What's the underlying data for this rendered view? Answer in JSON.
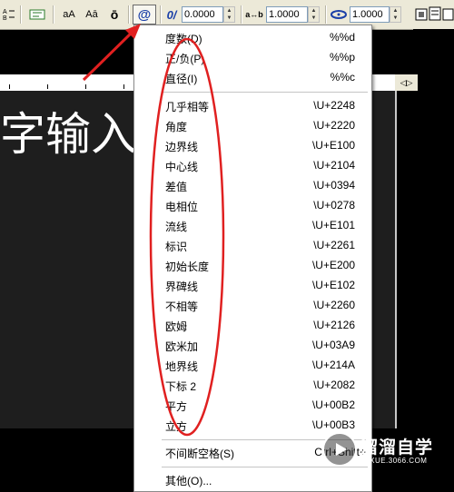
{
  "toolbar": {
    "btn_tracking": "aA",
    "btn_oblique": "Aā",
    "btn_overline": "ō",
    "btn_symbol": "@",
    "btn_angle_icon": "0/",
    "angle_value": "0.0000",
    "btn_kerning": "a↔b",
    "kerning_value": "1.0000",
    "width_value": "1.0000"
  },
  "editor": {
    "text": "字输入"
  },
  "menu": {
    "top_items": [
      {
        "label": "度数(D)",
        "code": "%%d"
      },
      {
        "label": "正/负(P)",
        "code": "%%p"
      },
      {
        "label": "直径(I)",
        "code": "%%c"
      }
    ],
    "symbol_items": [
      {
        "label": "几乎相等",
        "code": "\\U+2248"
      },
      {
        "label": "角度",
        "code": "\\U+2220"
      },
      {
        "label": "边界线",
        "code": "\\U+E100"
      },
      {
        "label": "中心线",
        "code": "\\U+2104"
      },
      {
        "label": "差值",
        "code": "\\U+0394"
      },
      {
        "label": "电相位",
        "code": "\\U+0278"
      },
      {
        "label": "流线",
        "code": "\\U+E101"
      },
      {
        "label": "标识",
        "code": "\\U+2261"
      },
      {
        "label": "初始长度",
        "code": "\\U+E200"
      },
      {
        "label": "界碑线",
        "code": "\\U+E102"
      },
      {
        "label": "不相等",
        "code": "\\U+2260"
      },
      {
        "label": "欧姆",
        "code": "\\U+2126"
      },
      {
        "label": "欧米加",
        "code": "\\U+03A9"
      },
      {
        "label": "地界线",
        "code": "\\U+214A"
      },
      {
        "label": "下标 2",
        "code": "\\U+2082"
      },
      {
        "label": "平方",
        "code": "\\U+00B2"
      },
      {
        "label": "立方",
        "code": "\\U+00B3"
      }
    ],
    "nbsp_label": "不间断空格(S)",
    "nbsp_shortcut": "Ctrl+Shift+",
    "other_label": "其他(O)..."
  },
  "watermark": {
    "title": "溜溜自学",
    "subtitle": "ZIXUE.3066.COM"
  },
  "colors": {
    "annotation": "#e02020",
    "menu_bg": "#ffffff",
    "toolbar_bg": "#ece9d8",
    "editor_bg": "#1e1e1e"
  }
}
